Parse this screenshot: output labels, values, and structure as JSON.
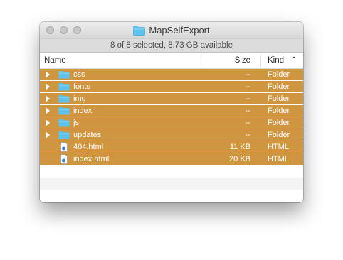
{
  "window": {
    "title": "MapSelfExport",
    "status": "8 of 8 selected, 8.73 GB available"
  },
  "columns": {
    "name": "Name",
    "size": "Size",
    "kind": "Kind"
  },
  "rows": [
    {
      "name": "css",
      "size": "--",
      "kind": "Folder",
      "type": "folder"
    },
    {
      "name": "fonts",
      "size": "--",
      "kind": "Folder",
      "type": "folder"
    },
    {
      "name": "img",
      "size": "--",
      "kind": "Folder",
      "type": "folder"
    },
    {
      "name": "index",
      "size": "--",
      "kind": "Folder",
      "type": "folder"
    },
    {
      "name": "js",
      "size": "--",
      "kind": "Folder",
      "type": "folder"
    },
    {
      "name": "updates",
      "size": "--",
      "kind": "Folder",
      "type": "folder"
    },
    {
      "name": "404.html",
      "size": "11 KB",
      "kind": "HTML",
      "type": "file"
    },
    {
      "name": "index.html",
      "size": "20 KB",
      "kind": "HTML",
      "type": "file"
    }
  ],
  "colors": {
    "selection": "#cf963f",
    "folder": "#5cc3f1",
    "stripe": "#f4f4f4"
  },
  "icons": {
    "folder": "folder-icon",
    "file": "html-file-icon",
    "disclosure": "disclosure-triangle-icon",
    "sort": "sort-ascending-icon"
  }
}
